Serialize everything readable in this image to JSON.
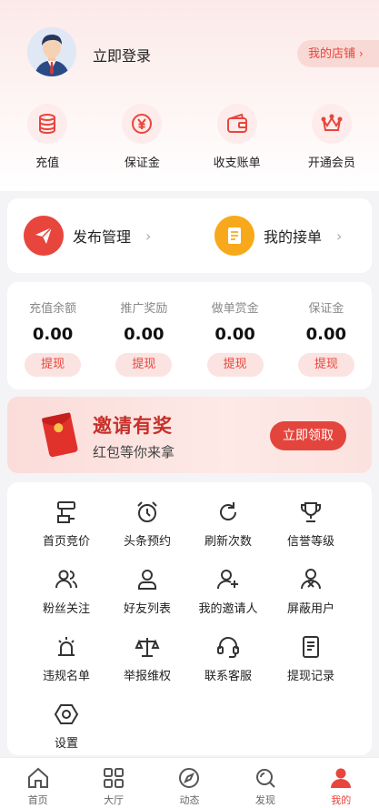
{
  "header": {
    "login_text": "立即登录",
    "shop_button": "我的店铺",
    "shop_chevron": "›"
  },
  "quick_actions": [
    {
      "label": "充值",
      "icon": "coins-icon"
    },
    {
      "label": "保证金",
      "icon": "yen-icon"
    },
    {
      "label": "收支账单",
      "icon": "wallet-icon"
    },
    {
      "label": "开通会员",
      "icon": "crown-icon"
    }
  ],
  "manage": {
    "publish_label": "发布管理",
    "orders_label": "我的接单",
    "chevron": "›"
  },
  "balances": [
    {
      "title": "充值余额",
      "value": "0.00",
      "action": "提现"
    },
    {
      "title": "推广奖励",
      "value": "0.00",
      "action": "提现"
    },
    {
      "title": "做单赏金",
      "value": "0.00",
      "action": "提现"
    },
    {
      "title": "保证金",
      "value": "0.00",
      "action": "提现"
    }
  ],
  "invite": {
    "title": "邀请有奖",
    "subtitle": "红包等你来拿",
    "button": "立即领取"
  },
  "tools": [
    {
      "label": "首页竞价",
      "icon": "bid-icon"
    },
    {
      "label": "头条预约",
      "icon": "alarm-clock-icon"
    },
    {
      "label": "刷新次数",
      "icon": "refresh-icon"
    },
    {
      "label": "信誉等级",
      "icon": "trophy-icon"
    },
    {
      "label": "粉丝关注",
      "icon": "fans-icon"
    },
    {
      "label": "好友列表",
      "icon": "friend-icon"
    },
    {
      "label": "我的邀请人",
      "icon": "user-add-icon"
    },
    {
      "label": "屏蔽用户",
      "icon": "user-block-icon"
    },
    {
      "label": "违规名单",
      "icon": "alarm-light-icon"
    },
    {
      "label": "举报维权",
      "icon": "scale-icon"
    },
    {
      "label": "联系客服",
      "icon": "headset-icon"
    },
    {
      "label": "提现记录",
      "icon": "document-icon"
    },
    {
      "label": "设置",
      "icon": "settings-hexagon-icon"
    }
  ],
  "nav": [
    {
      "label": "首页",
      "icon": "home-icon",
      "active": false
    },
    {
      "label": "大厅",
      "icon": "grid-icon",
      "active": false
    },
    {
      "label": "动态",
      "icon": "compass-icon",
      "active": false
    },
    {
      "label": "发现",
      "icon": "search-icon",
      "active": false
    },
    {
      "label": "我的",
      "icon": "person-icon",
      "active": true
    }
  ],
  "colors": {
    "accent": "#e8453c",
    "accent_light": "#fbe3e1",
    "orange": "#f7a91b"
  }
}
